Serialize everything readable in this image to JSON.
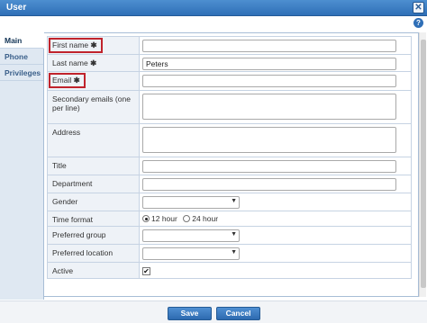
{
  "window": {
    "title": "User",
    "close_glyph": "✕",
    "help_glyph": "?"
  },
  "tabs": [
    {
      "label": "Main",
      "active": true
    },
    {
      "label": "Phone",
      "active": false
    },
    {
      "label": "Privileges",
      "active": false
    }
  ],
  "required_marker": "✱",
  "fields": {
    "first_name": {
      "label": "First name",
      "value": ""
    },
    "last_name": {
      "label": "Last name",
      "value": "Peters"
    },
    "email": {
      "label": "Email",
      "value": ""
    },
    "secondary_emails": {
      "label": "Secondary emails (one per line)",
      "value": ""
    },
    "address": {
      "label": "Address",
      "value": ""
    },
    "title": {
      "label": "Title",
      "value": ""
    },
    "department": {
      "label": "Department",
      "value": ""
    },
    "gender": {
      "label": "Gender",
      "value": ""
    },
    "time_format": {
      "label": "Time format",
      "options": [
        "12 hour",
        "24 hour"
      ],
      "selected": "12 hour"
    },
    "preferred_group": {
      "label": "Preferred group",
      "value": ""
    },
    "preferred_location": {
      "label": "Preferred location",
      "value": ""
    },
    "active": {
      "label": "Active",
      "checked": true
    }
  },
  "footer": {
    "save_label": "Save",
    "cancel_label": "Cancel"
  },
  "colors": {
    "titlebar": "#2f6fb7",
    "highlight_border": "#c0232c",
    "button": "#2d6ab0"
  },
  "icons": {
    "close": "close-icon",
    "help": "help-icon",
    "dropdown": "chevron-down-icon",
    "check": "checkmark-icon"
  }
}
